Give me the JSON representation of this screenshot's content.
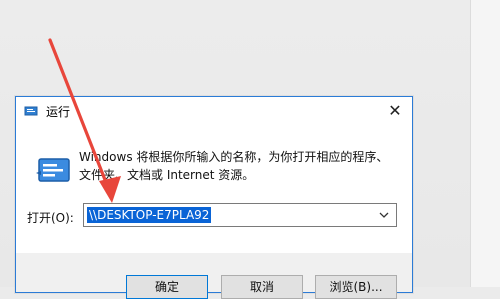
{
  "window": {
    "title": "运行",
    "close_symbol": "✕"
  },
  "description": {
    "line1": "Windows 将根据你所输入的名称，为你打开相应的程序、",
    "line2": "文件夹、文档或 Internet 资源。"
  },
  "open_field": {
    "label": "打开(O):",
    "value": "\\\\DESKTOP-E7PLA92"
  },
  "buttons": {
    "ok": "确定",
    "cancel": "取消",
    "browse": "浏览(B)..."
  },
  "colors": {
    "accent": "#0a64d6",
    "dialog_border": "#2b7bd6",
    "annotation_arrow": "#e8463b"
  },
  "icons": {
    "title": "run-icon",
    "main": "run-program-icon",
    "dropdown": "chevron-down-icon",
    "close": "close-icon"
  }
}
